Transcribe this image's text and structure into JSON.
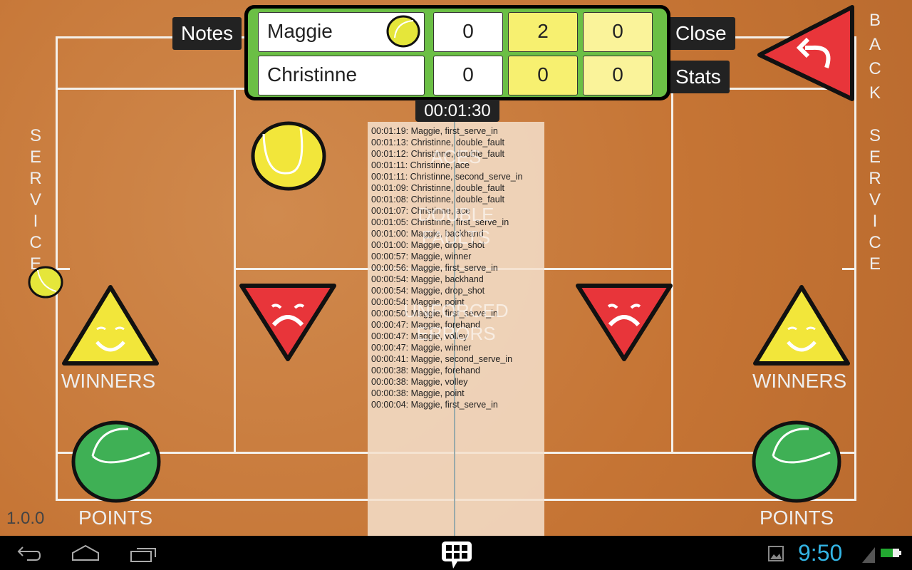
{
  "scoreboard": {
    "players": [
      {
        "name": "Maggie",
        "serving": true,
        "scores": [
          "0",
          "2",
          "0"
        ]
      },
      {
        "name": "Christinne",
        "serving": false,
        "scores": [
          "0",
          "0",
          "0"
        ]
      }
    ],
    "timer": "00:01:30"
  },
  "buttons": {
    "notes": "Notes",
    "close": "Close",
    "stats": "Stats",
    "back": "BACK"
  },
  "court": {
    "service_left": "SERVICE",
    "service_right": "SERVICE",
    "winners_left": "WINNERS",
    "winners_right": "WINNERS",
    "points_left": "POINTS",
    "points_right": "POINTS",
    "aces": "ACES",
    "double_faults": "DOUBLE FAULTS",
    "unforced_errors": "UNFORCED ERRORS"
  },
  "version": "1.0.0",
  "log": [
    "00:01:19: Maggie, first_serve_in",
    "00:01:13: Christinne, double_fault",
    "00:01:12: Christinne, double_fault",
    "00:01:11: Christinne, ace",
    "00:01:11: Christinne, second_serve_in",
    "00:01:09: Christinne, double_fault",
    "00:01:08: Christinne, double_fault",
    "00:01:07: Christinne, ace",
    "00:01:05: Christinne, first_serve_in",
    "00:01:00: Maggie, backhand",
    "00:01:00: Maggie, drop_shot",
    "00:00:57: Maggie, winner",
    "00:00:56: Maggie, first_serve_in",
    "00:00:54: Maggie, backhand",
    "00:00:54: Maggie, drop_shot",
    "00:00:54: Maggie, point",
    "00:00:50: Maggie, first_serve_in",
    "00:00:47: Maggie, forehand",
    "00:00:47: Maggie, volley",
    "00:00:47: Maggie, winner",
    "00:00:41: Maggie, second_serve_in",
    "00:00:38: Maggie, forehand",
    "00:00:38: Maggie, volley",
    "00:00:38: Maggie, point",
    "00:00:04: Maggie, first_serve_in"
  ],
  "statusbar": {
    "time": "9:50"
  },
  "colors": {
    "court": "#c57434",
    "scoreboard": "#6bbf45",
    "yellow_cell": "#f7f070",
    "winner": "#f2e63a",
    "error": "#e8353a",
    "point": "#3fb055",
    "clock": "#33b5e5"
  }
}
